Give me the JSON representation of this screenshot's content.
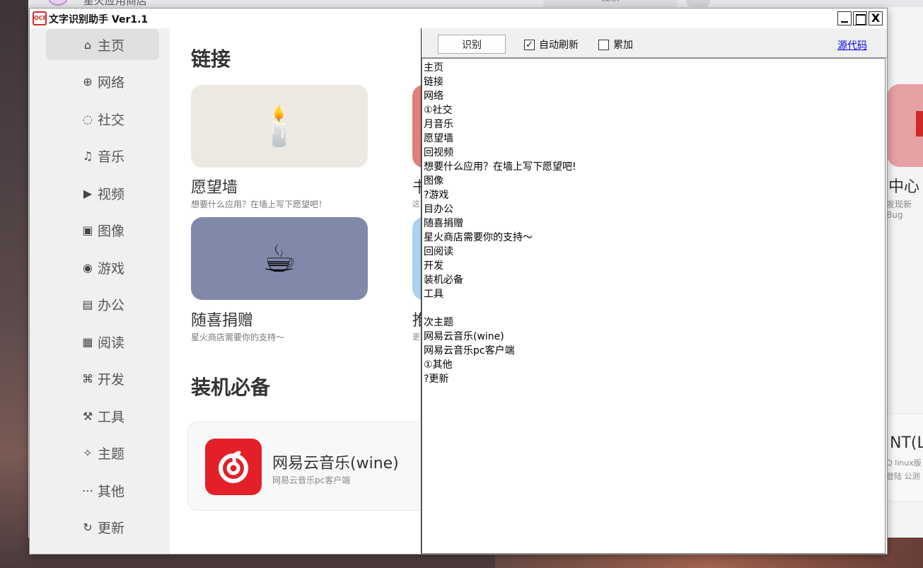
{
  "background_app": {
    "title": "星火应用商店",
    "search": "搜索",
    "right_card_title": "中心",
    "right_card_desc": "发现新Bug",
    "right_card2_title": "NT(L",
    "right_card2_desc1": "Q linux版",
    "right_card2_desc2": "登陆 公测"
  },
  "window": {
    "icon_text": "OCR",
    "title": "文字识别助手 Ver1.1",
    "min": "_",
    "max": "□",
    "close": "X"
  },
  "sidebar": {
    "items": [
      {
        "label": "主页",
        "icon": "home-icon",
        "glyph": "⌂"
      },
      {
        "label": "网络",
        "icon": "globe-icon",
        "glyph": "⊕"
      },
      {
        "label": "社交",
        "icon": "chat-icon",
        "glyph": "◌"
      },
      {
        "label": "音乐",
        "icon": "music-icon",
        "glyph": "♫"
      },
      {
        "label": "视频",
        "icon": "video-icon",
        "glyph": "▶"
      },
      {
        "label": "图像",
        "icon": "image-icon",
        "glyph": "▣"
      },
      {
        "label": "游戏",
        "icon": "gamepad-icon",
        "glyph": "◉"
      },
      {
        "label": "办公",
        "icon": "document-icon",
        "glyph": "▤"
      },
      {
        "label": "阅读",
        "icon": "book-icon",
        "glyph": "▦"
      },
      {
        "label": "开发",
        "icon": "code-icon",
        "glyph": "⌘"
      },
      {
        "label": "工具",
        "icon": "toolbox-icon",
        "glyph": "⚒"
      },
      {
        "label": "主题",
        "icon": "wand-icon",
        "glyph": "✧"
      },
      {
        "label": "其他",
        "icon": "more-icon",
        "glyph": "⋯"
      },
      {
        "label": "更新",
        "icon": "refresh-icon",
        "glyph": "↻"
      }
    ]
  },
  "content": {
    "section_links": "链接",
    "cards": [
      {
        "title": "愿望墙",
        "desc": "想要什么应用？在墙上写下愿望吧！",
        "emoji": "🕯️",
        "color": "#ede9e2"
      },
      {
        "title": "随喜捐赠",
        "desc": "星火商店需要你的支持～",
        "emoji": "☕",
        "color": "#8189ab"
      }
    ],
    "peek_title_1": "书",
    "peek_desc_1": "这",
    "peek_title_2": "推",
    "peek_desc_2": "更",
    "section_essentials": "装机必备",
    "app": {
      "name": "网易云音乐(wine)",
      "desc": "网易云音乐pc客户端"
    }
  },
  "panel": {
    "recognize_button": "识别",
    "auto_refresh_label": "自动刷新",
    "auto_refresh_checked": true,
    "accumulate_label": "累加",
    "accumulate_checked": false,
    "source_link": "源代码",
    "ocr_text": "主页\n链接\n网络\n①社交\n月音乐\n愿望墙\n回视频\n想要什么应用？在墙上写下愿望吧!\n图像\n?游戏\n目办公\n随喜捐赠\n星火商店需要你的支持～\n回阅读\n开发\n装机必备\n工具\n\n次主题\n网易云音乐(wine)\n网易云音乐pc客户端\n①其他\n?更新"
  }
}
